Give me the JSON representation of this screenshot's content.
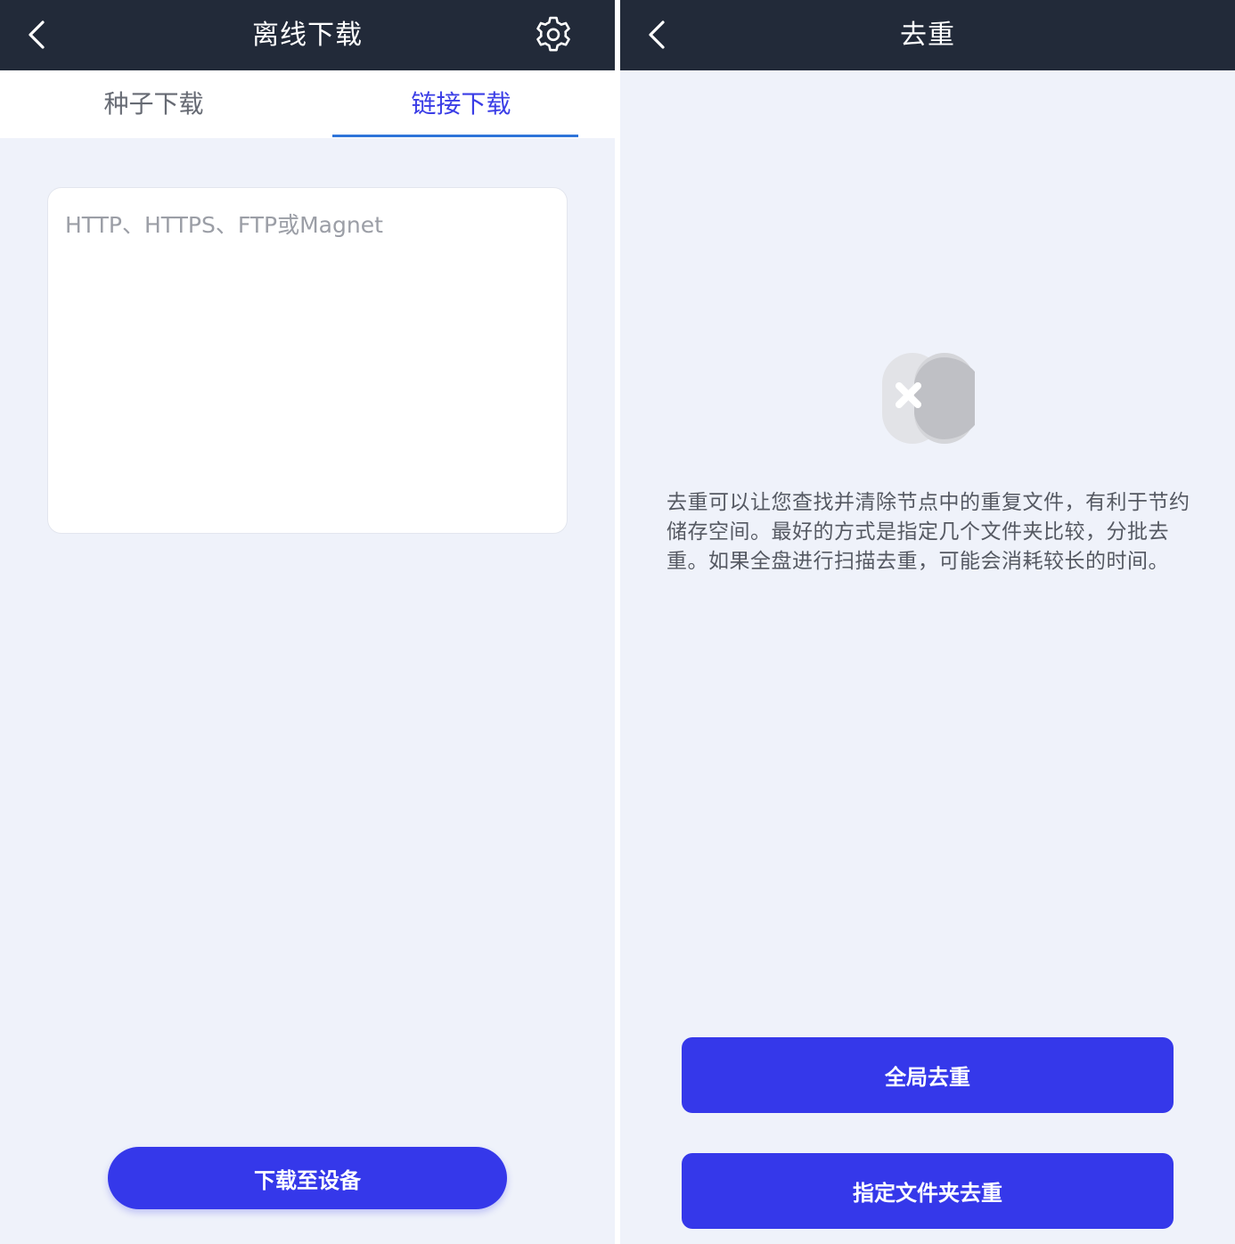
{
  "offline_download": {
    "header": {
      "title": "离线下载",
      "back_icon": "chevron-left-icon",
      "settings_icon": "gear-icon"
    },
    "tabs": [
      {
        "label": "种子下载",
        "active": false
      },
      {
        "label": "链接下载",
        "active": true
      }
    ],
    "url_input": {
      "value": "",
      "placeholder": "HTTP、HTTPS、FTP或Magnet"
    },
    "download_button_label": "下载至设备"
  },
  "dedupe": {
    "header": {
      "title": "去重",
      "back_icon": "chevron-left-icon"
    },
    "illustration_icon": "duplicate-remove-icon",
    "description": "去重可以让您查找并清除节点中的重复文件，有利于节约储存空间。最好的方式是指定几个文件夹比较，分批去重。如果全盘进行扫描去重，可能会消耗较长的时间。",
    "global_button_label": "全局去重",
    "folder_button_label": "指定文件夹去重"
  },
  "colors": {
    "header_bg": "#222a39",
    "page_bg": "#eff2fa",
    "accent": "#3538ea",
    "active_tab_text": "#3a3de6",
    "tab_underline": "#2f74d9"
  }
}
